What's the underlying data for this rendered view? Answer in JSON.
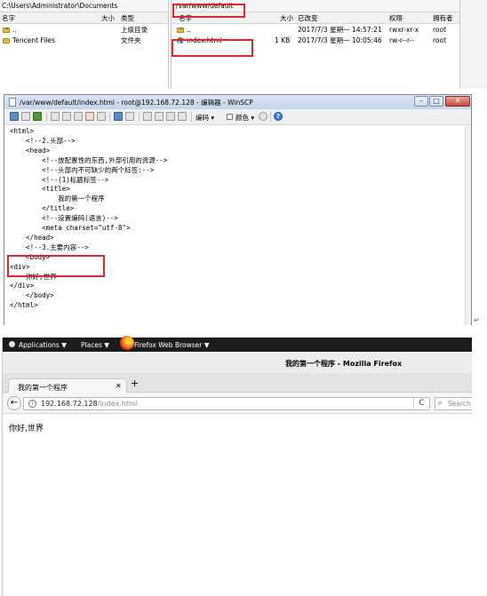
{
  "local_panel": {
    "path": "C:\\Users\\Administrator\\Documents",
    "columns": [
      "名字",
      "大小",
      "类型"
    ],
    "rows": [
      {
        "name": "..",
        "size": "",
        "type": "上级目录",
        "icon": "parent-folder-icon"
      },
      {
        "name": "Tencent Files",
        "size": "",
        "type": "文件夹",
        "icon": "folder-icon"
      }
    ]
  },
  "remote_panel": {
    "path": "/var/www/default",
    "columns": [
      "名字",
      "大小",
      "已改变",
      "权限",
      "拥有者"
    ],
    "rows": [
      {
        "name": "..",
        "size": "",
        "changed": "2017/7/3 星期一 14:57:21",
        "rights": "rwxr-xr-x",
        "owner": "root",
        "icon": "parent-folder-icon"
      },
      {
        "name": "index.html",
        "size": "1 KB",
        "changed": "2017/7/3 星期一 10:05:46",
        "rights": "rw-r--r--",
        "owner": "root",
        "icon": "chrome-icon"
      }
    ]
  },
  "editor": {
    "title": "/var/www/default/index.html - root@192.168.72.128 - 编辑器 - WinSCP",
    "toolbar": {
      "encoding_label": "编码",
      "color_label": "颜色"
    },
    "code_lines": [
      "<html>",
      "    <!--2.头部-->",
      "    <head>",
      "        <!--放配置性的东西,外部引用的资源-->",
      "        <!--头部内不可缺少的两个标签:-->",
      "        <!--(1)标题标签-->",
      "        <title>",
      "            我的第一个程序",
      "        </title>",
      "        <!--设置编码(语言)-->",
      "        <meta charset=\"utf-8\">",
      "    </head>",
      "    <!--3.主要内容-->",
      "    <body>",
      "<div>",
      "    你好,世界",
      "</div>",
      "    </body>",
      "</html>"
    ]
  },
  "firefox": {
    "top_bar": {
      "applications": "Applications ▼",
      "places": "Places ▼",
      "browser": "Firefox Web Browser ▼"
    },
    "window_title": "我的第一个程序 - Mozilla Firefox",
    "tab_title": "我的第一个程序",
    "url_host": "192.168.72.128",
    "url_path": "/index.html",
    "search_placeholder": "Search",
    "page_content": "你好,世界"
  }
}
